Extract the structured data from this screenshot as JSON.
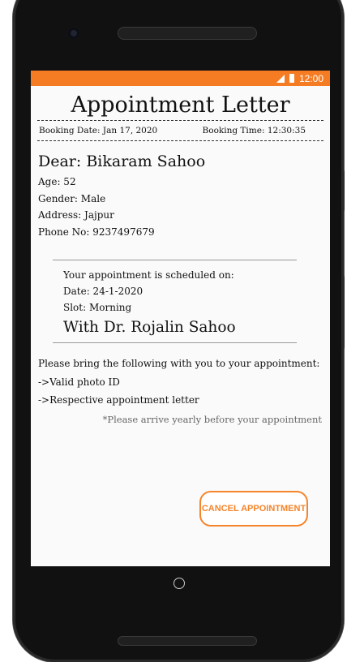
{
  "status_bar": {
    "time": "12:00"
  },
  "title": "Appointment Letter",
  "booking": {
    "date": "Booking Date: Jan 17, 2020",
    "time": "Booking Time: 12:30:35"
  },
  "patient": {
    "dear": "Dear: Bikaram Sahoo",
    "age": "Age: 52",
    "gender": "Gender: Male",
    "address": "Address: Jajpur",
    "phone": "Phone No: 9237497679"
  },
  "appointment": {
    "scheduled": "Your appointment is scheduled on:",
    "date": "Date: 24-1-2020",
    "slot": "Slot: Morning",
    "doctor": "With Dr. Rojalin Sahoo"
  },
  "instructions": {
    "bring": "Please bring the following with you to your appointment:",
    "items": [
      "->Valid photo ID",
      "->Respective appointment letter"
    ],
    "note": "*Please arrive yearly before your appointment"
  },
  "cancel_label": "CANCEL APPOINTMENT"
}
